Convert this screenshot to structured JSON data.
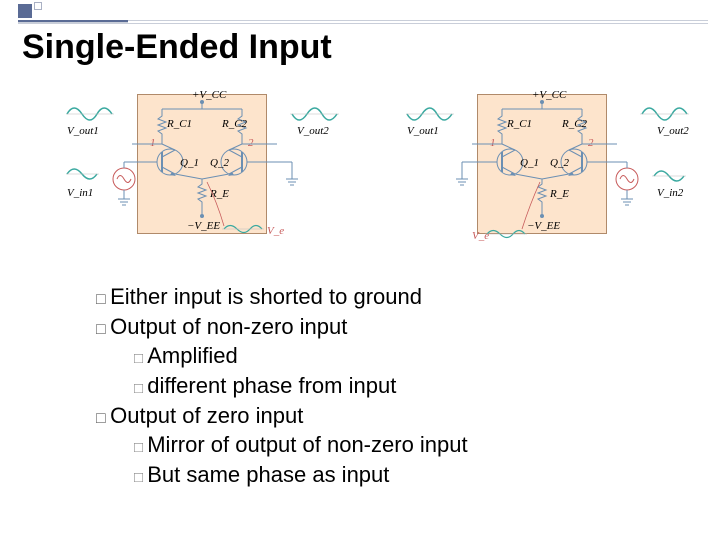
{
  "title": "Single-Ended Input",
  "diagrams": {
    "left": {
      "labels": {
        "vcc": "+V_CC",
        "rc1": "R_C1",
        "rc2": "R_C2",
        "q1": "Q_1",
        "q2": "Q_2",
        "re": "R_E",
        "vee": "−V_EE",
        "vout1": "V_out1",
        "vout2": "V_out2",
        "vin1": "V_in1",
        "ve": "V_e",
        "node1": "1",
        "node2": "2"
      }
    },
    "right": {
      "labels": {
        "vcc": "+V_CC",
        "rc1": "R_C1",
        "rc2": "R_C2",
        "q1": "Q_1",
        "q2": "Q_2",
        "re": "R_E",
        "vee": "−V_EE",
        "vout1": "V_out1",
        "vout2": "V_out2",
        "vin2": "V_in2",
        "ve": "V_e",
        "node1": "1",
        "node2": "2"
      }
    }
  },
  "bullets": [
    "Either input is shorted to ground",
    "Output of non-zero input",
    "Amplified",
    "different phase from input",
    "Output of zero input",
    "Mirror of output of non-zero input",
    "But same phase as input"
  ],
  "colors": {
    "wave_teal": "#3aa9a0",
    "wave_red": "#c75b5b",
    "wire": "#6b8fb3",
    "wire_red": "#c75b5b",
    "panel": "#fde4cc"
  }
}
